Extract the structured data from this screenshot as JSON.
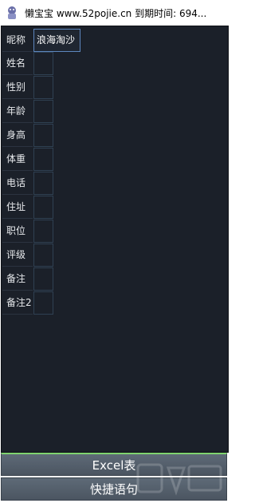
{
  "window": {
    "title": "懒宝宝 www.52pojie.cn 到期时间: 694...",
    "icon": "cartoon-app-icon"
  },
  "form": {
    "rows": [
      {
        "label": "昵称",
        "value": "浪海淘沙"
      },
      {
        "label": "姓名",
        "value": ""
      },
      {
        "label": "性别",
        "value": ""
      },
      {
        "label": "年龄",
        "value": ""
      },
      {
        "label": "身高",
        "value": ""
      },
      {
        "label": "体重",
        "value": ""
      },
      {
        "label": "电话",
        "value": ""
      },
      {
        "label": "住址",
        "value": ""
      },
      {
        "label": "职位",
        "value": ""
      },
      {
        "label": "评级",
        "value": ""
      },
      {
        "label": "备注",
        "value": ""
      },
      {
        "label": "备注2",
        "value": ""
      }
    ]
  },
  "buttons": {
    "excel_label": "Excel表",
    "quick_phrases_label": "快捷语句"
  },
  "colors": {
    "panel_bg": "#1b2029",
    "text": "#e6e8eb",
    "focus_border": "#5c86bd",
    "accent_line": "#7fd36f"
  }
}
